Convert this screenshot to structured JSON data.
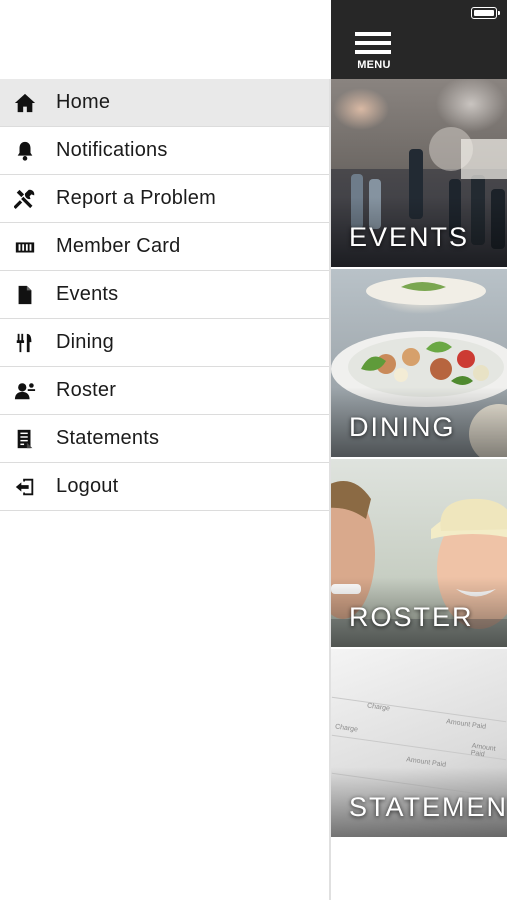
{
  "drawer": {
    "items": [
      {
        "label": "Home",
        "icon": "home-icon",
        "active": true
      },
      {
        "label": "Notifications",
        "icon": "bell-icon",
        "active": false
      },
      {
        "label": "Report a Problem",
        "icon": "tools-icon",
        "active": false
      },
      {
        "label": "Member Card",
        "icon": "card-icon",
        "active": false
      },
      {
        "label": "Events",
        "icon": "document-icon",
        "active": false
      },
      {
        "label": "Dining",
        "icon": "utensils-icon",
        "active": false
      },
      {
        "label": "Roster",
        "icon": "person-icon",
        "active": false
      },
      {
        "label": "Statements",
        "icon": "statement-icon",
        "active": false
      },
      {
        "label": "Logout",
        "icon": "logout-icon",
        "active": false
      }
    ]
  },
  "topbar": {
    "menu_label": "MENU",
    "background": "#272727"
  },
  "tiles": [
    {
      "label": "EVENTS"
    },
    {
      "label": "DINING"
    },
    {
      "label": "ROSTER"
    },
    {
      "label": "STATEMENTS"
    }
  ],
  "statement_image_text": [
    "Charge",
    "Amount Paid",
    "Charge",
    "Amount Paid",
    "Amount Paid"
  ],
  "colors": {
    "active_item_bg": "#e9e9e9",
    "text": "#1b1b1b",
    "divider": "#dcdcdc"
  }
}
